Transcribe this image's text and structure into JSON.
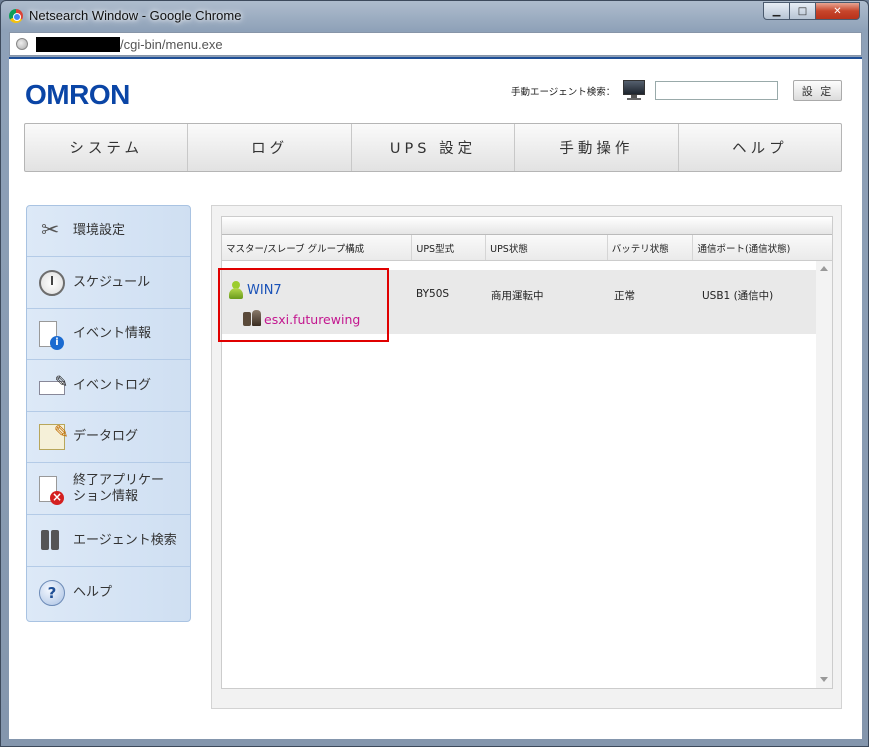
{
  "window": {
    "title": "Netsearch Window - Google Chrome",
    "url": "/cgi-bin/menu.exe",
    "minimize": "▁",
    "maximize": "□",
    "close": "✕"
  },
  "header": {
    "logo": "OMRON",
    "agent_search_label": "手動エージェント検索：",
    "set_button": "設 定"
  },
  "nav": {
    "tabs": [
      {
        "label": "システム"
      },
      {
        "label": "ログ"
      },
      {
        "label": "UPS 設定"
      },
      {
        "label": "手動操作"
      },
      {
        "label": "ヘルプ"
      }
    ]
  },
  "sidebar": {
    "items": [
      {
        "label": "環境設定",
        "icon": "tools-icon"
      },
      {
        "label": "スケジュール",
        "icon": "clock-icon"
      },
      {
        "label": "イベント情報",
        "icon": "event-info-icon"
      },
      {
        "label": "イベントログ",
        "icon": "keyboard-pen-icon"
      },
      {
        "label": "データログ",
        "icon": "notepad-icon"
      },
      {
        "label": "終了アプリケーション情報",
        "label_line1": "終了アプリケー",
        "label_line2": "ション情報",
        "icon": "shutdown-app-icon"
      },
      {
        "label": "エージェント検索",
        "icon": "binoculars-icon"
      },
      {
        "label": "ヘルプ",
        "icon": "help-icon"
      }
    ]
  },
  "grid": {
    "columns": [
      "マスター/スレーブ グループ構成",
      "UPS型式",
      "UPS状態",
      "バッテリ状態",
      "通信ポート(通信状態)"
    ],
    "rows": [
      {
        "master": "WIN7",
        "slave": "esxi.futurewing",
        "model": "BY50S",
        "ups_status": "商用運転中",
        "battery": "正常",
        "port": "USB1 (通信中)"
      }
    ]
  },
  "colors": {
    "brand": "#0a45a6",
    "master_link": "#1a52b8",
    "slave_link": "#c3168f",
    "highlight": "#e00000"
  }
}
